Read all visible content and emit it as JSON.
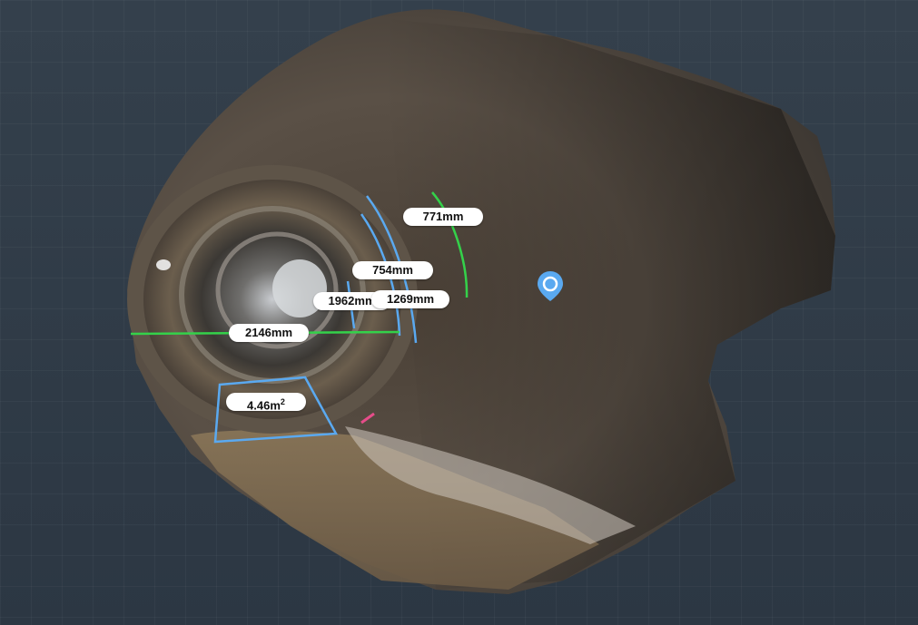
{
  "measurements": {
    "m771": "771mm",
    "m754": "754mm",
    "m1962": "1962mm",
    "m1269": "1269mm",
    "m2146": "2146mm"
  },
  "area": {
    "value": "4.46m",
    "unit_sup": "2"
  },
  "colors": {
    "background": "#2e3945",
    "measure_green": "#34d14a",
    "measure_blue": "#5aa9f0",
    "label_bg": "#ffffff",
    "pin": "#5aa9f0"
  },
  "icons": {
    "location_pin": "location-pin-icon"
  }
}
